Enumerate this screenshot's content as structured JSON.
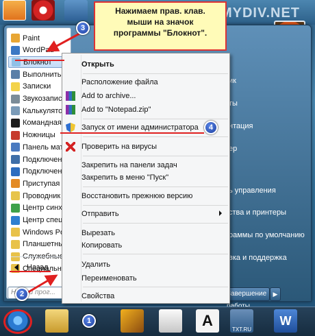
{
  "watermark": "MYDIV.NET",
  "tooltip": {
    "line1": "Нажимаем прав. клав.",
    "line2": "мыши на значок",
    "line3": "программы \"Блокнот\"."
  },
  "programs": [
    {
      "label": "Paint",
      "color": "#e8a634"
    },
    {
      "label": "WordPad",
      "color": "#3b78c4"
    },
    {
      "label": "Блокнот",
      "color": "#8fc1e8",
      "selected": true
    },
    {
      "label": "Выполнить",
      "color": "#5a7fa8"
    },
    {
      "label": "Записки",
      "color": "#f3d34a"
    },
    {
      "label": "Звукозапись",
      "color": "#7a8c98"
    },
    {
      "label": "Калькулятор",
      "color": "#7a9bb8"
    },
    {
      "label": "Командная строка",
      "color": "#1b1b1b"
    },
    {
      "label": "Ножницы",
      "color": "#c63a2d"
    },
    {
      "label": "Панель математического ввода",
      "color": "#4a7ac0"
    },
    {
      "label": "Подключение к сетевому проектору",
      "color": "#3f6fa8"
    },
    {
      "label": "Подключение к удаленному рабочему столу",
      "color": "#2d6dbf"
    },
    {
      "label": "Приступая к работе",
      "color": "#e38a24"
    },
    {
      "label": "Проводник",
      "color": "#e7c44b"
    },
    {
      "label": "Центр синхронизации",
      "color": "#3ea14a"
    },
    {
      "label": "Центр специальных возможностей",
      "color": "#2e7fd0"
    },
    {
      "label": "Windows PowerShell",
      "color": "#e8c24a"
    },
    {
      "label": "Планшетный ПК",
      "color": "#e8c24a"
    },
    {
      "label": "Служебные",
      "color": "#e8c24a"
    },
    {
      "label": "Специальные возможности",
      "color": "#e8c24a"
    }
  ],
  "back_label": "Назад",
  "search_placeholder": "Найти прог...",
  "right_links": [
    "ик",
    "ты",
    "нтация",
    "ер",
    "ь управления",
    "ства и принтеры",
    "раммы по умолчанию",
    "вка и поддержка"
  ],
  "shutdown_label": "Завершение работы",
  "context_menu": {
    "open": "Открыть",
    "file_location": "Расположение файла",
    "add_archive": "Add to archive...",
    "add_zip": "Add to \"Notepad.zip\"",
    "run_as_admin": "Запуск от имени администратора",
    "scan_virus": "Проверить на вирусы",
    "pin_taskbar": "Закрепить на панели задач",
    "pin_start": "Закрепить в меню \"Пуск\"",
    "restore_prev": "Восстановить прежнюю версию",
    "send_to": "Отправить",
    "cut": "Вырезать",
    "copy": "Копировать",
    "delete": "Удалить",
    "rename": "Переименовать",
    "properties": "Свойства"
  },
  "badges": {
    "b1": "1",
    "b2": "2",
    "b3": "3",
    "b4": "4"
  },
  "taskbar_icon_text": "TXT.RU",
  "colors": {
    "accent_red": "#e02020",
    "tooltip_bg": "#fffbb8",
    "badge_blue": "#1d3f9e"
  }
}
